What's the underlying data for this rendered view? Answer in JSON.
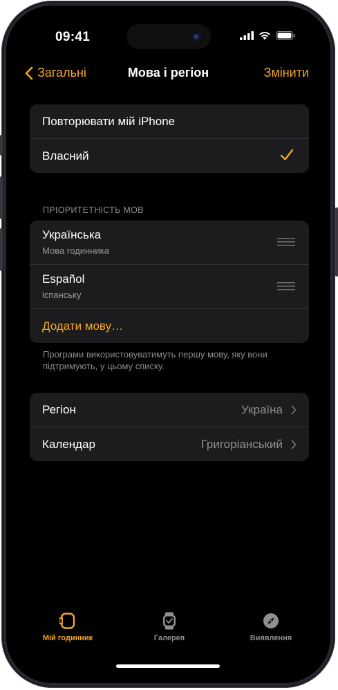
{
  "status_bar": {
    "time": "09:41"
  },
  "nav": {
    "back_label": "Загальні",
    "title": "Мова і регіон",
    "edit_label": "Змінити"
  },
  "language_mode": {
    "items": [
      {
        "label": "Повторювати мій iPhone",
        "selected": false
      },
      {
        "label": "Власний",
        "selected": true
      }
    ]
  },
  "language_priority": {
    "header": "ПРІОРИТЕТНІСТЬ МОВ",
    "languages": [
      {
        "name": "Українська",
        "subtitle": "Мова годинника"
      },
      {
        "name": "Español",
        "subtitle": "іспанську"
      }
    ],
    "add_label": "Додати мову…",
    "footnote": "Програми використовуватимуть першу мову, яку вони підтримують, у цьому списку."
  },
  "region_settings": {
    "region": {
      "label": "Регіон",
      "value": "Україна"
    },
    "calendar": {
      "label": "Календар",
      "value": "Григоріанський"
    }
  },
  "tab_bar": {
    "tabs": [
      {
        "label": "Мій годинник",
        "icon": "watch-icon",
        "active": true
      },
      {
        "label": "Галерея",
        "icon": "gallery-watch-icon",
        "active": false
      },
      {
        "label": "Виявлення",
        "icon": "compass-icon",
        "active": false
      }
    ]
  },
  "colors": {
    "accent": "#f5a623",
    "background": "#000000",
    "cell": "#1c1c1e",
    "secondary_text": "#8e8e93"
  }
}
